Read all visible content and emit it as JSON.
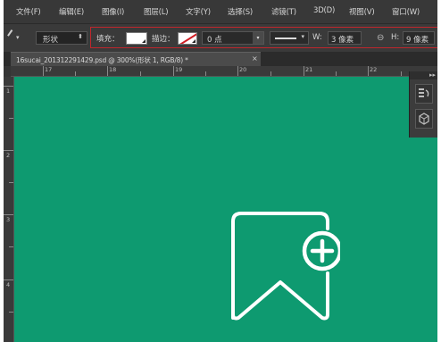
{
  "menu": [
    "文件(F)",
    "编辑(E)",
    "图像(I)",
    "图层(L)",
    "文字(Y)",
    "选择(S)",
    "滤镜(T)",
    "3D(D)",
    "视图(V)",
    "窗口(W)"
  ],
  "options": {
    "mode": "形状",
    "fill_label": "填充：",
    "stroke_label": "描边：",
    "stroke_width": "0 点",
    "w_label": "W:",
    "w_value": "3 像素",
    "h_label": "H:",
    "h_value": "9 像素"
  },
  "document": {
    "tab_title": "16sucai_201312291429.psd @ 300%(形状 1, RGB/8) *",
    "close": "×"
  },
  "rulers": {
    "top": [
      "17",
      "18",
      "19",
      "20",
      "21",
      "22"
    ],
    "left": [
      "1",
      "2",
      "3",
      "4"
    ]
  },
  "colors": {
    "canvas": "#0e9a70",
    "highlight": "#c0262c",
    "graphic": "#ffffff"
  },
  "icons": {
    "panel_history": "history-icon",
    "panel_3d": "cube-icon",
    "canvas_graphic": "bookmark-plus-icon"
  }
}
